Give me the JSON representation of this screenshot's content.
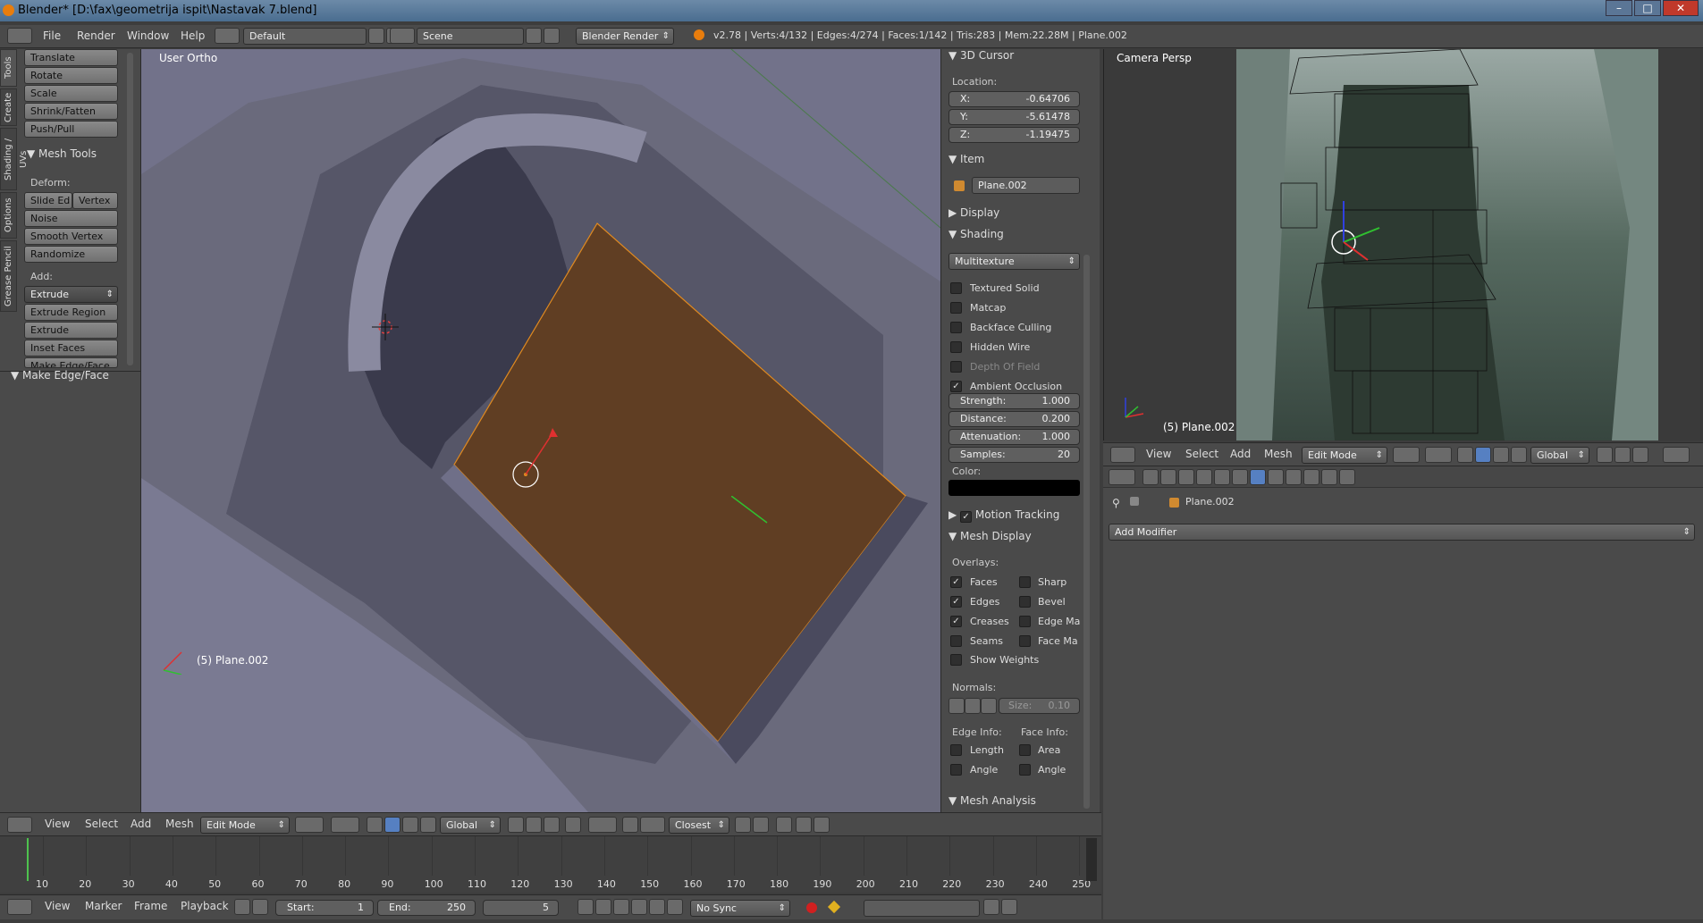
{
  "window": {
    "title": "Blender* [D:\\fax\\geometrija ispit\\Nastavak 7.blend]"
  },
  "info": {
    "menus": [
      "File",
      "Render",
      "Window",
      "Help"
    ],
    "layout": "Default",
    "scene": "Scene",
    "engine": "Blender Render",
    "stats": "v2.78 | Verts:4/132 | Edges:4/274 | Faces:1/142 | Tris:283 | Mem:22.28M | Plane.002"
  },
  "toolshelf": {
    "tabs": [
      "Tools",
      "Create",
      "Shading / UVs",
      "Options",
      "Grease Pencil"
    ],
    "transform": [
      "Translate",
      "Rotate",
      "Scale",
      "Shrink/Fatten",
      "Push/Pull"
    ],
    "mesh_tools_title": "Mesh Tools",
    "deform_label": "Deform:",
    "slide_edge": "Slide Ed",
    "vertex": "Vertex",
    "deform": [
      "Noise",
      "Smooth Vertex",
      "Randomize"
    ],
    "add_label": "Add:",
    "extrude": "Extrude",
    "add": [
      "Extrude Region",
      "Extrude Individual",
      "Inset Faces",
      "Make Edge/Face"
    ],
    "operator_title": "Make Edge/Face"
  },
  "viewport": {
    "view_name": "User Ortho",
    "object_label": "(5) Plane.002"
  },
  "properties": {
    "cursor_title": "3D Cursor",
    "location_label": "Location:",
    "x": {
      "k": "X:",
      "v": "-0.64706"
    },
    "y": {
      "k": "Y:",
      "v": "-5.61478"
    },
    "z": {
      "k": "Z:",
      "v": "-1.19475"
    },
    "item_title": "Item",
    "item_name": "Plane.002",
    "display_title": "Display",
    "shading_title": "Shading",
    "shading_mode": "Multitexture",
    "shading_opts": [
      {
        "label": "Textured Solid",
        "checked": false
      },
      {
        "label": "Matcap",
        "checked": false
      },
      {
        "label": "Backface Culling",
        "checked": false
      },
      {
        "label": "Hidden Wire",
        "checked": false
      },
      {
        "label": "Depth Of Field",
        "checked": false
      },
      {
        "label": "Ambient Occlusion",
        "checked": true
      }
    ],
    "ao": [
      {
        "k": "Strength:",
        "v": "1.000"
      },
      {
        "k": "Distance:",
        "v": "0.200"
      },
      {
        "k": "Attenuation:",
        "v": "1.000"
      },
      {
        "k": "Samples:",
        "v": "20"
      }
    ],
    "color_label": "Color:",
    "motion_title": "Motion Tracking",
    "mesh_display_title": "Mesh Display",
    "overlays_label": "Overlays:",
    "overlays_left": [
      {
        "label": "Faces",
        "checked": true
      },
      {
        "label": "Edges",
        "checked": true
      },
      {
        "label": "Creases",
        "checked": true
      },
      {
        "label": "Seams",
        "checked": false
      }
    ],
    "overlays_right": [
      {
        "label": "Sharp",
        "checked": false
      },
      {
        "label": "Bevel",
        "checked": false
      },
      {
        "label": "Edge Ma",
        "checked": false
      },
      {
        "label": "Face Ma",
        "checked": false
      }
    ],
    "show_weights": "Show Weights",
    "normals_label": "Normals:",
    "normals_size": "Size:",
    "normals_size_value": "0.10",
    "edge_info": "Edge Info:",
    "face_info": "Face Info:",
    "length": "Length",
    "area": "Area",
    "angle": "Angle",
    "mesh_analysis_title": "Mesh Analysis"
  },
  "view_header": {
    "menus": [
      "View",
      "Select",
      "Add",
      "Mesh"
    ],
    "mode": "Edit Mode",
    "orientation": "Global",
    "snap": "Closest"
  },
  "camera_view": {
    "view_name": "Camera Persp",
    "object_label": "(5) Plane.002"
  },
  "right_header": {
    "menus": [
      "View",
      "Select",
      "Add",
      "Mesh"
    ],
    "mode": "Edit Mode",
    "orientation": "Global"
  },
  "modifier": {
    "object": "Plane.002",
    "add_modifier": "Add Modifier"
  },
  "timeline": {
    "ticks": [
      "10",
      "20",
      "30",
      "40",
      "50",
      "60",
      "70",
      "80",
      "90",
      "100",
      "110",
      "120",
      "130",
      "140",
      "150",
      "160",
      "170",
      "180",
      "190",
      "200",
      "210",
      "220",
      "230",
      "240",
      "250"
    ],
    "menus": [
      "View",
      "Marker",
      "Frame",
      "Playback"
    ],
    "start_label": "Start:",
    "start": "1",
    "end_label": "End:",
    "end": "250",
    "current": "5",
    "sync": "No Sync"
  }
}
